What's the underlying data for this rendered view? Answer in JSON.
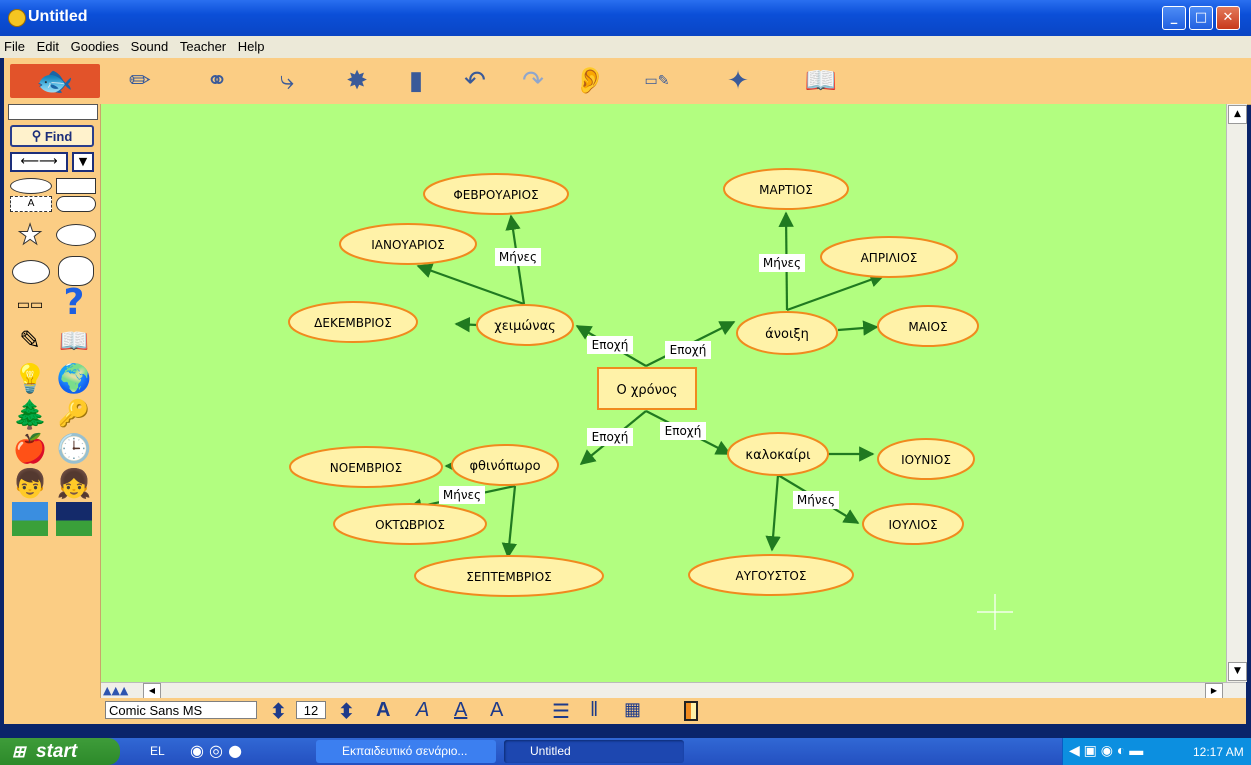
{
  "window": {
    "title": "Untitled"
  },
  "menu": [
    "File",
    "Edit",
    "Goodies",
    "Sound",
    "Teacher",
    "Help"
  ],
  "palette": {
    "find_label": "Find",
    "text_box_glyph": "A"
  },
  "canvas": {
    "bg": "#b2fe80",
    "node_fill": "#fff2a8",
    "node_stroke": "#f08a1e",
    "arrow_color": "#207a20",
    "center": "Ο χρόνος",
    "nodes": {
      "winter": "χειμώνας",
      "spring": "άνοιξη",
      "autumn": "φθινόπωρο",
      "summer": "καλοκαίρι",
      "feb": "ΦΕΒΡΟΥΑΡΙΟΣ",
      "jan": "ΙΑΝΟΥΑΡΙΟΣ",
      "dec": "ΔΕΚΕΜΒΡΙΟΣ",
      "mar": "ΜΑΡΤΙΟΣ",
      "apr": "ΑΠΡΙΛΙΟΣ",
      "may": "ΜΑΙΟΣ",
      "nov": "ΝΟΕΜΒΡΙΟΣ",
      "oct": "ΟΚΤΩΒΡΙΟΣ",
      "sep": "ΣΕΠΤΕΜΒΡΙΟΣ",
      "jun": "ΙΟΥΝΙΟΣ",
      "jul": "ΙΟΥΛΙΟΣ",
      "aug": "ΑΥΓΟΥΣΤΟΣ"
    },
    "links": {
      "season": "Εποχή",
      "months": "Μήνες"
    }
  },
  "fontbar": {
    "font_name": "Comic Sans MS",
    "font_size": "12"
  },
  "taskbar": {
    "start": "start",
    "lang": "EL",
    "tasks": [
      "Εκπαιδευτικό σενάριο...",
      "Untitled"
    ],
    "clock": "12:17 AM"
  }
}
